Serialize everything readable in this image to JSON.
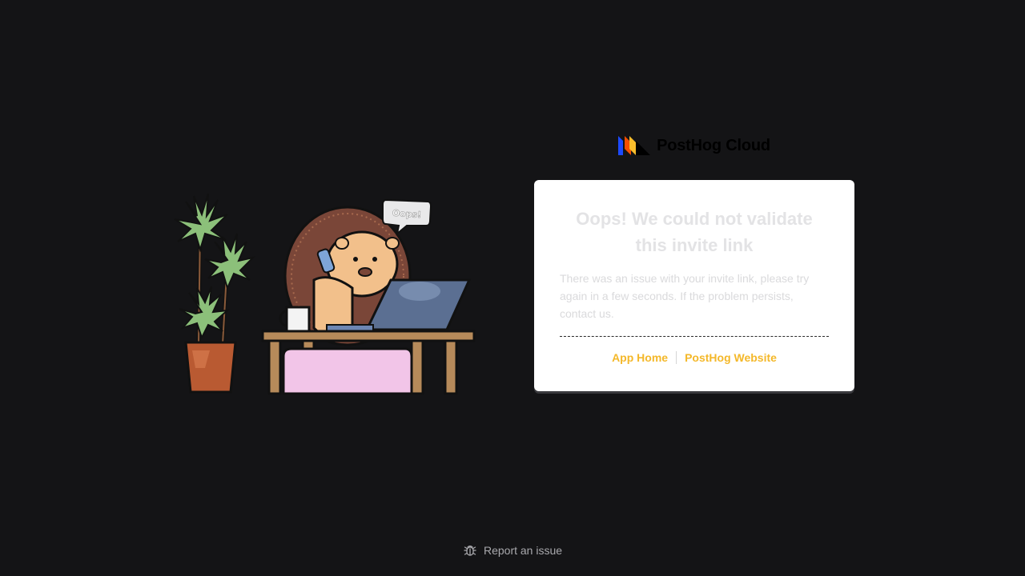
{
  "brand": {
    "name": "PostHog Cloud",
    "logo_icon": "posthog-logo-icon"
  },
  "illustration": {
    "bubble_text": "Oops!",
    "icon": "hedgehog-at-desk-illustration"
  },
  "card": {
    "title": "Oops! We could not validate this invite link",
    "message": "There was an issue with your invite link, please try again in a few seconds. If the problem persists, contact us.",
    "links": [
      {
        "label": "App Home"
      },
      {
        "label": "PostHog Website"
      }
    ]
  },
  "footer": {
    "report_label": "Report an issue",
    "icon": "bug-icon"
  },
  "colors": {
    "background": "#141416",
    "card": "#ffffff",
    "link": "#f4b82a",
    "title": "#e3e3e5",
    "footer_text": "#a9a9ad"
  }
}
